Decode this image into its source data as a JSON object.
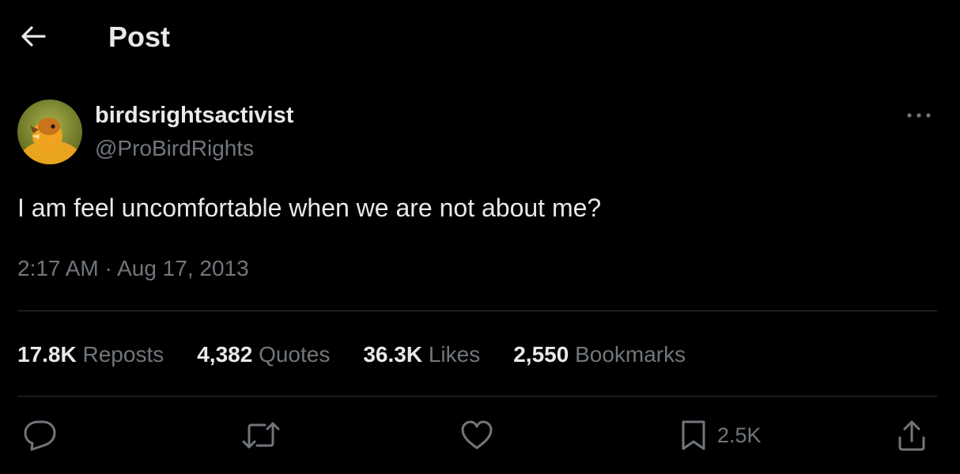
{
  "header": {
    "title": "Post"
  },
  "author": {
    "display_name": "birdsrightsactivist",
    "handle": "@ProBirdRights"
  },
  "tweet": {
    "text": "I am feel uncomfortable when we are not about me?",
    "time": "2:17 AM",
    "separator": "·",
    "date": "Aug 17, 2013"
  },
  "stats": [
    {
      "value": "17.8K",
      "label": "Reposts"
    },
    {
      "value": "4,382",
      "label": "Quotes"
    },
    {
      "value": "36.3K",
      "label": "Likes"
    },
    {
      "value": "2,550",
      "label": "Bookmarks"
    }
  ],
  "actions": {
    "bookmark_count": "2.5K"
  },
  "icons": {
    "back": "arrow-left-icon",
    "more": "more-dots-icon",
    "reply": "reply-icon",
    "repost": "repost-icon",
    "like": "heart-icon",
    "bookmark": "bookmark-icon",
    "share": "share-icon"
  },
  "colors": {
    "background": "#000000",
    "primary_text": "#e7e9ea",
    "secondary_text": "#71767b",
    "divider": "#2f3336"
  }
}
